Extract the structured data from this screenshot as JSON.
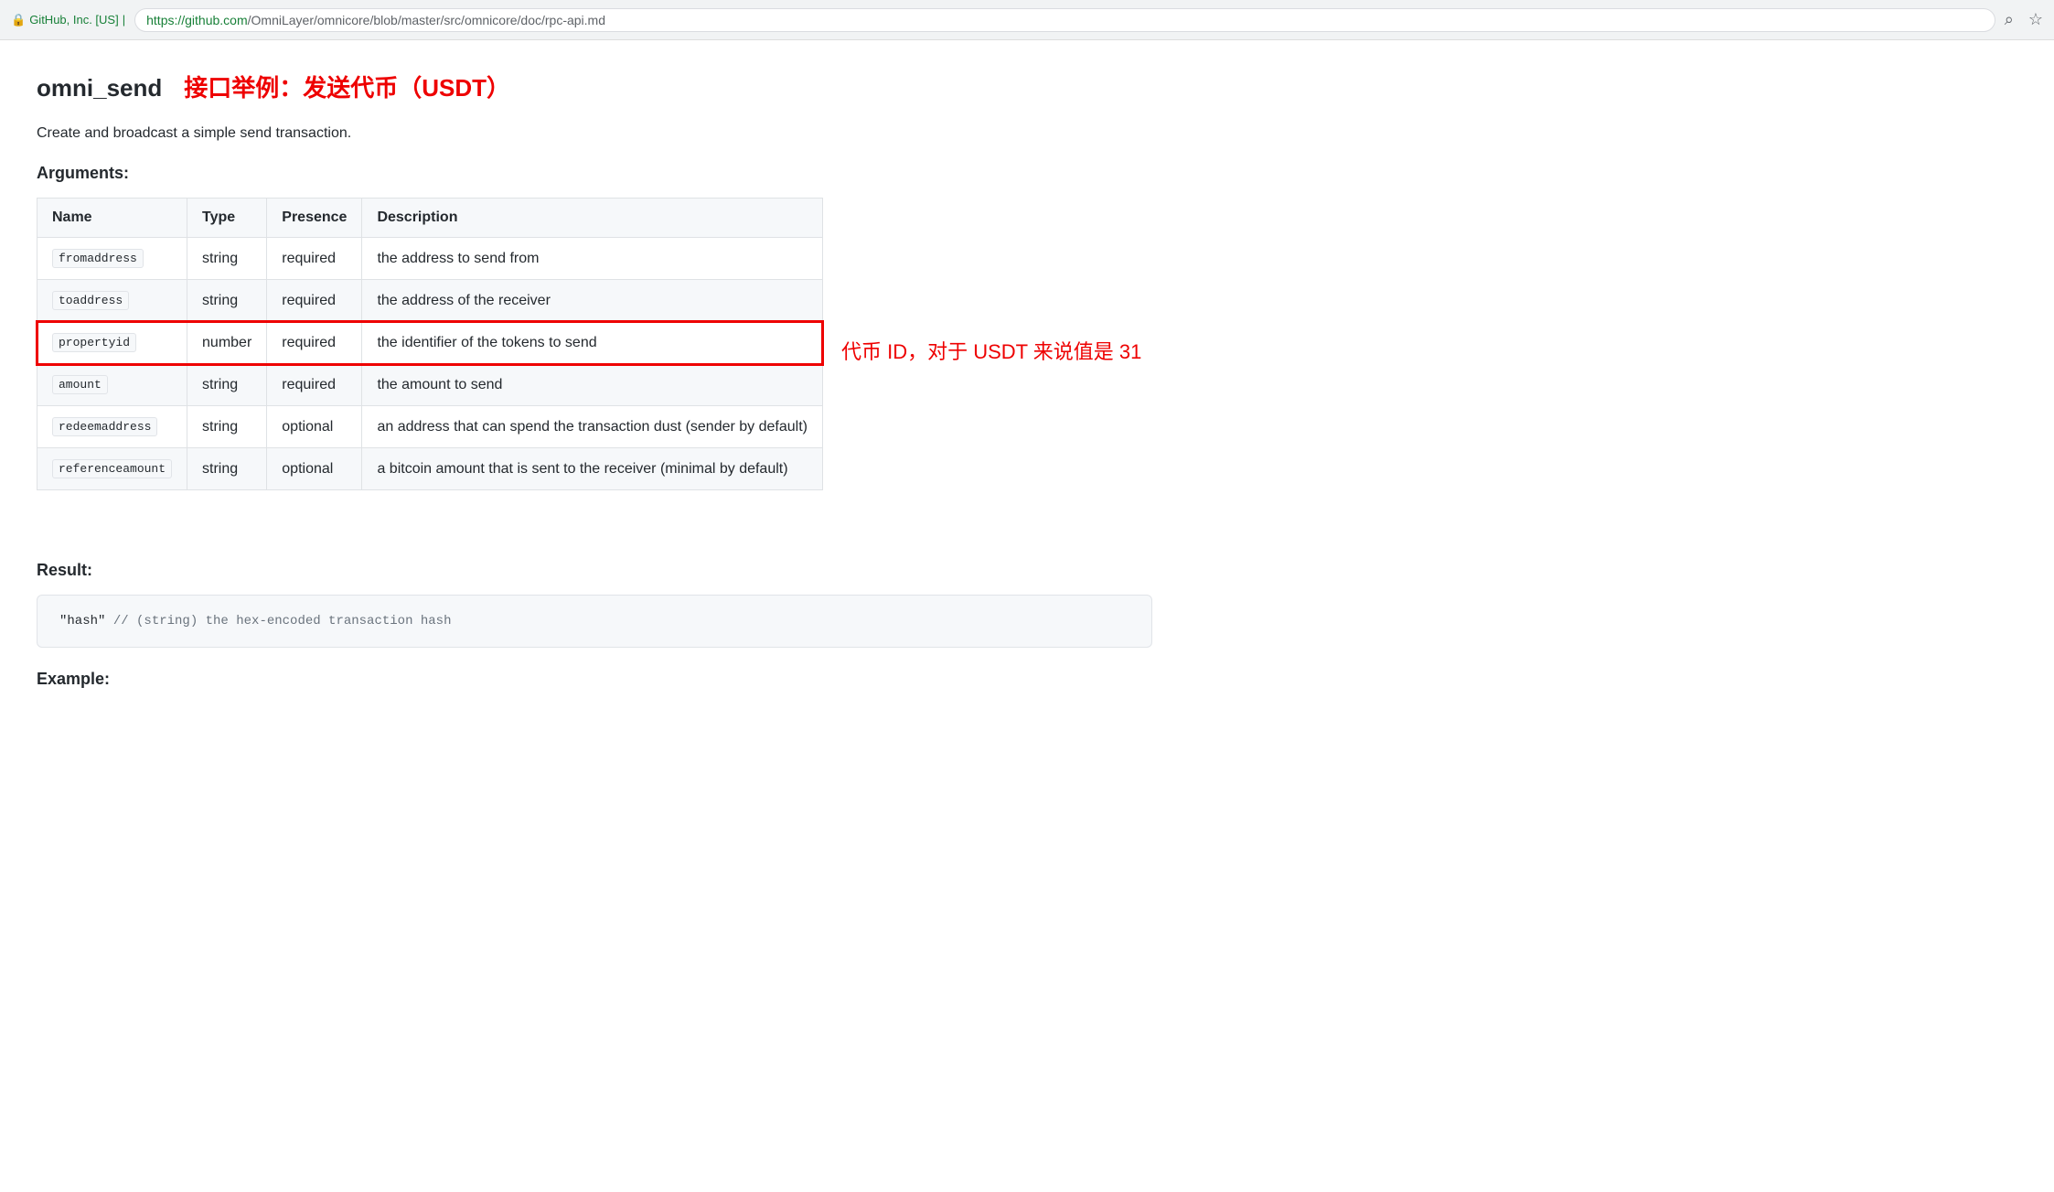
{
  "browser": {
    "lock_icon": "🔒",
    "company": "GitHub, Inc. [US]",
    "separator": "|",
    "url_origin": "https://github.com",
    "url_path": "/OmniLayer/omnicore/blob/master/src/omnicore/doc/rpc-api.md",
    "search_icon": "⌕",
    "star_icon": "☆"
  },
  "header": {
    "api_name": "omni_send",
    "subtitle": "接口举例：发送代币（USDT）",
    "description": "Create and broadcast a simple send transaction."
  },
  "arguments": {
    "section_title": "Arguments:",
    "table": {
      "columns": [
        "Name",
        "Type",
        "Presence",
        "Description"
      ],
      "rows": [
        {
          "name": "fromaddress",
          "type": "string",
          "presence": "required",
          "description": "the address to send from",
          "highlighted": false
        },
        {
          "name": "toaddress",
          "type": "string",
          "presence": "required",
          "description": "the address of the receiver",
          "highlighted": false
        },
        {
          "name": "propertyid",
          "type": "number",
          "presence": "required",
          "description": "the identifier of the tokens to send",
          "highlighted": true
        },
        {
          "name": "amount",
          "type": "string",
          "presence": "required",
          "description": "the amount to send",
          "highlighted": false
        },
        {
          "name": "redeemaddress",
          "type": "string",
          "presence": "optional",
          "description": "an address that can spend the transaction dust (sender by default)",
          "highlighted": false
        },
        {
          "name": "referenceamount",
          "type": "string",
          "presence": "optional",
          "description": "a bitcoin amount that is sent to the receiver (minimal by default)",
          "highlighted": false
        }
      ]
    },
    "annotation": "代币 ID，对于 USDT 来说值是 31"
  },
  "result": {
    "section_title": "Result:",
    "code": "\"hash\"  // (string) the hex-encoded transaction hash"
  },
  "example": {
    "section_title": "Example:"
  }
}
